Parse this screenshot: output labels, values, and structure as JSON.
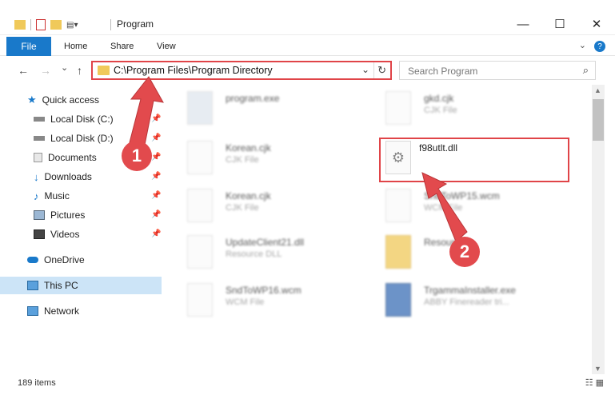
{
  "window": {
    "title": "Program",
    "minimize": "—",
    "maximize": "☐",
    "close": "✕"
  },
  "ribbon": {
    "file": "File",
    "tabs": [
      "Home",
      "Share",
      "View"
    ],
    "help": "?"
  },
  "navigation": {
    "back": "←",
    "forward": "→",
    "recent": "⌄",
    "up": "↑",
    "address": "C:\\Program Files\\Program Directory",
    "search_placeholder": "Search Program"
  },
  "sidebar": {
    "quick_access": "Quick access",
    "items": [
      {
        "label": "Local Disk (C:)",
        "icon": "drive-icon",
        "pinned": true
      },
      {
        "label": "Local Disk (D:)",
        "icon": "drive-icon",
        "pinned": true
      },
      {
        "label": "Documents",
        "icon": "documents-icon",
        "pinned": true
      },
      {
        "label": "Downloads",
        "icon": "downloads-icon",
        "pinned": true
      },
      {
        "label": "Music",
        "icon": "music-icon",
        "pinned": true
      },
      {
        "label": "Pictures",
        "icon": "pictures-icon",
        "pinned": true
      },
      {
        "label": "Videos",
        "icon": "videos-icon",
        "pinned": true
      }
    ],
    "onedrive": "OneDrive",
    "this_pc": "This PC",
    "network": "Network"
  },
  "files": {
    "left": [
      {
        "name": "program.exe",
        "type": ""
      },
      {
        "name": "Korean.cjk",
        "type": "CJK File"
      },
      {
        "name": "Korean.cjk",
        "type": "CJK File"
      },
      {
        "name": "UpdateClient21.dll",
        "type": "Resource DLL"
      },
      {
        "name": "SndToWP16.wcm",
        "type": "WCM File"
      }
    ],
    "right": [
      {
        "name": "gkd.cjk",
        "type": "CJK File"
      },
      {
        "name": "f98utlt.dll",
        "type": ""
      },
      {
        "name": "SndToWP15.wcm",
        "type": "WCM File"
      },
      {
        "name": "Resources",
        "type": ""
      },
      {
        "name": "TrgammaInstaller.exe",
        "type": "ABBY Finereader tri..."
      }
    ]
  },
  "annotations": {
    "step1": "1",
    "step2": "2"
  },
  "status": {
    "count": "189 items"
  },
  "colors": {
    "accent": "#1979ca",
    "highlight": "#e04448",
    "selection": "#cce4f7"
  }
}
